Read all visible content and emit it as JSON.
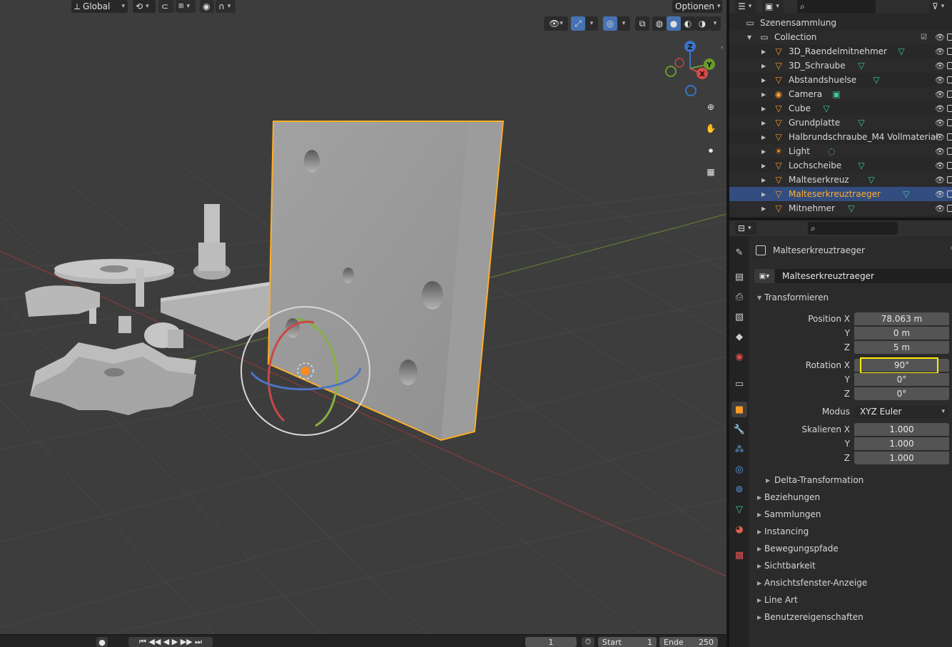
{
  "viewport": {
    "header": {
      "orientation": "Global",
      "options": "Optionen"
    }
  },
  "timeline": {
    "frame": "1",
    "start_label": "Start",
    "start_value": "1",
    "end_label": "Ende",
    "end_value": "250"
  },
  "outliner": {
    "root": "Szenensammlung",
    "collection": "Collection",
    "items": [
      {
        "label": "3D_Raendelmitnehmer",
        "icon": "mesh-object-icon",
        "data": "mesh-data-icon"
      },
      {
        "label": "3D_Schraube",
        "icon": "mesh-object-icon",
        "data": "mesh-data-icon"
      },
      {
        "label": "Abstandshuelse",
        "icon": "mesh-object-icon",
        "data": "mesh-data-icon"
      },
      {
        "label": "Camera",
        "icon": "camera-object-icon",
        "data": "camera-data-icon"
      },
      {
        "label": "Cube",
        "icon": "mesh-object-icon",
        "data": "mesh-data-icon"
      },
      {
        "label": "Grundplatte",
        "icon": "mesh-object-icon",
        "data": "mesh-data-icon"
      },
      {
        "label": "Halbrundschraube_M4 Vollmaterial",
        "icon": "mesh-object-icon",
        "data": ""
      },
      {
        "label": "Light",
        "icon": "light-object-icon",
        "data": "light-data-icon"
      },
      {
        "label": "Lochscheibe",
        "icon": "mesh-object-icon",
        "data": "mesh-data-icon"
      },
      {
        "label": "Malteserkreuz",
        "icon": "mesh-object-icon",
        "data": "mesh-data-icon"
      },
      {
        "label": "Malteserkreuztraeger",
        "icon": "mesh-object-icon",
        "data": "mesh-data-icon",
        "selected": true
      },
      {
        "label": "Mitnehmer",
        "icon": "mesh-object-icon",
        "data": "mesh-data-icon"
      }
    ]
  },
  "properties": {
    "context_name": "Malteserkreuztraeger",
    "object_name": "Malteserkreuztraeger",
    "transform": {
      "title": "Transformieren",
      "position_label": "Position X",
      "position": [
        "78.063 m",
        "0 m",
        "5 m"
      ],
      "rotation_label": "Rotation X",
      "rotation": [
        "90°",
        "0°",
        "0°"
      ],
      "mode_label": "Modus",
      "mode": "XYZ Euler",
      "scale_label": "Skalieren X",
      "scale": [
        "1.000",
        "1.000",
        "1.000"
      ],
      "y_label": "Y",
      "z_label": "Z",
      "delta": "Delta-Transformation"
    },
    "panels": [
      "Beziehungen",
      "Sammlungen",
      "Instancing",
      "Bewegungspfade",
      "Sichtbarkeit",
      "Ansichtsfenster-Anzeige",
      "Line Art",
      "Benutzereigenschaften"
    ]
  },
  "gizmo_axes": {
    "x": "X",
    "y": "Y",
    "z": "Z"
  },
  "colors": {
    "selection": "#ffaf29",
    "highlight": "#ffee00",
    "active_tab": "#4772b3"
  }
}
